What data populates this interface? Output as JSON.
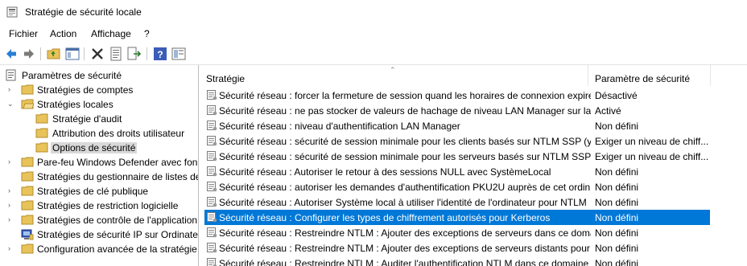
{
  "window": {
    "title": "Stratégie de sécurité locale"
  },
  "menu": [
    "Fichier",
    "Action",
    "Affichage",
    "?"
  ],
  "toolbar": {
    "icons": [
      "back-arrow-icon",
      "forward-arrow-icon",
      "up-folder-icon",
      "show-hide-tree-icon",
      "delete-icon",
      "properties-icon",
      "export-list-icon",
      "help-icon",
      "console-tree-icon"
    ]
  },
  "tree": {
    "root": "Paramètres de sécurité",
    "nodes": [
      {
        "label": "Stratégies de comptes"
      },
      {
        "label": "Stratégies locales"
      },
      {
        "label": "Stratégie d'audit"
      },
      {
        "label": "Attribution des droits utilisateur"
      },
      {
        "label": "Options de sécurité"
      },
      {
        "label": "Pare-feu Windows Defender avec fon"
      },
      {
        "label": "Stratégies du gestionnaire de listes de"
      },
      {
        "label": "Stratégies de clé publique"
      },
      {
        "label": "Stratégies de restriction logicielle"
      },
      {
        "label": "Stratégies de contrôle de l'application"
      },
      {
        "label": "Stratégies de sécurité IP sur Ordinate"
      },
      {
        "label": "Configuration avancée de la stratégie"
      }
    ]
  },
  "list": {
    "columns": {
      "policy": "Stratégie",
      "setting": "Paramètre de sécurité"
    },
    "rows": [
      {
        "name": "Sécurité réseau : forcer la fermeture de session quand les horaires de connexion expire...",
        "value": "Désactivé"
      },
      {
        "name": "Sécurité réseau : ne pas stocker de valeurs de hachage de niveau LAN Manager sur la ...",
        "value": "Activé"
      },
      {
        "name": "Sécurité réseau : niveau d'authentification LAN Manager",
        "value": "Non défini"
      },
      {
        "name": "Sécurité réseau : sécurité de session minimale pour les clients basés sur NTLM SSP (y ...",
        "value": "Exiger un niveau de chiff..."
      },
      {
        "name": "Sécurité réseau : sécurité de session minimale pour les serveurs basés sur NTLM SSP (...",
        "value": "Exiger un niveau de chiff..."
      },
      {
        "name": "Sécurité réseau : Autoriser le retour à des sessions NULL avec SystèmeLocal",
        "value": "Non défini"
      },
      {
        "name": "Sécurité réseau : autoriser les demandes d'authentification PKU2U auprès de cet ordin...",
        "value": "Non défini"
      },
      {
        "name": "Sécurité réseau : Autoriser Système local à utiliser l'identité de l'ordinateur pour NTLM",
        "value": "Non défini"
      },
      {
        "name": "Sécurité réseau : Configurer les types de chiffrement autorisés pour Kerberos",
        "value": "Non défini"
      },
      {
        "name": "Sécurité réseau : Restreindre NTLM : Ajouter des exceptions de serveurs dans ce doma...",
        "value": "Non défini"
      },
      {
        "name": "Sécurité réseau : Restreindre NTLM : Ajouter des exceptions de serveurs distants pour ...",
        "value": "Non défini"
      },
      {
        "name": "Sécurité réseau : Restreindre NTLM : Auditer l'authentification NTLM dans ce domaine",
        "value": "Non défini"
      }
    ]
  },
  "colors": {
    "selection": "#0078d7",
    "tree_selection": "#d9d9d9",
    "folder": "#e8c35a"
  }
}
